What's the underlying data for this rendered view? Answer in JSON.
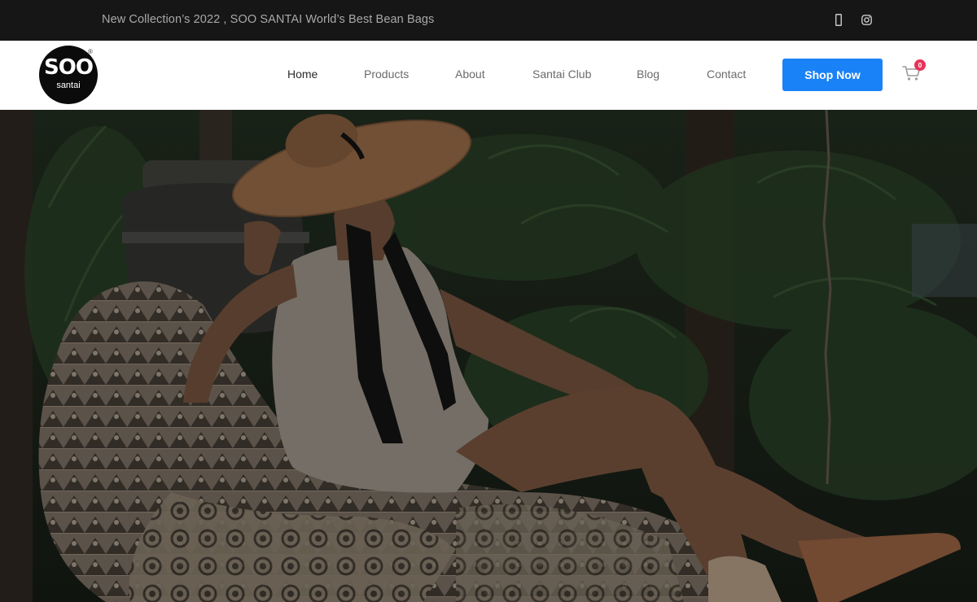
{
  "topbar": {
    "announcement": "New Collection’s 2022 , SOO SANTAI World’s Best Bean Bags",
    "social": [
      {
        "icon": "facebook-icon"
      },
      {
        "icon": "instagram-icon"
      }
    ]
  },
  "header": {
    "logo": {
      "primary": "SOO",
      "secondary": "santai",
      "mark": "®"
    },
    "nav": [
      {
        "label": "Home",
        "active": true
      },
      {
        "label": "Products",
        "active": false
      },
      {
        "label": "About",
        "active": false
      },
      {
        "label": "Santai Club",
        "active": false
      },
      {
        "label": "Blog",
        "active": false
      },
      {
        "label": "Contact",
        "active": false
      }
    ],
    "cta_label": "Shop Now",
    "cart_count": "0"
  },
  "colors": {
    "topbar_bg": "#161616",
    "accent": "#1a82f7",
    "badge": "#e8345a"
  }
}
